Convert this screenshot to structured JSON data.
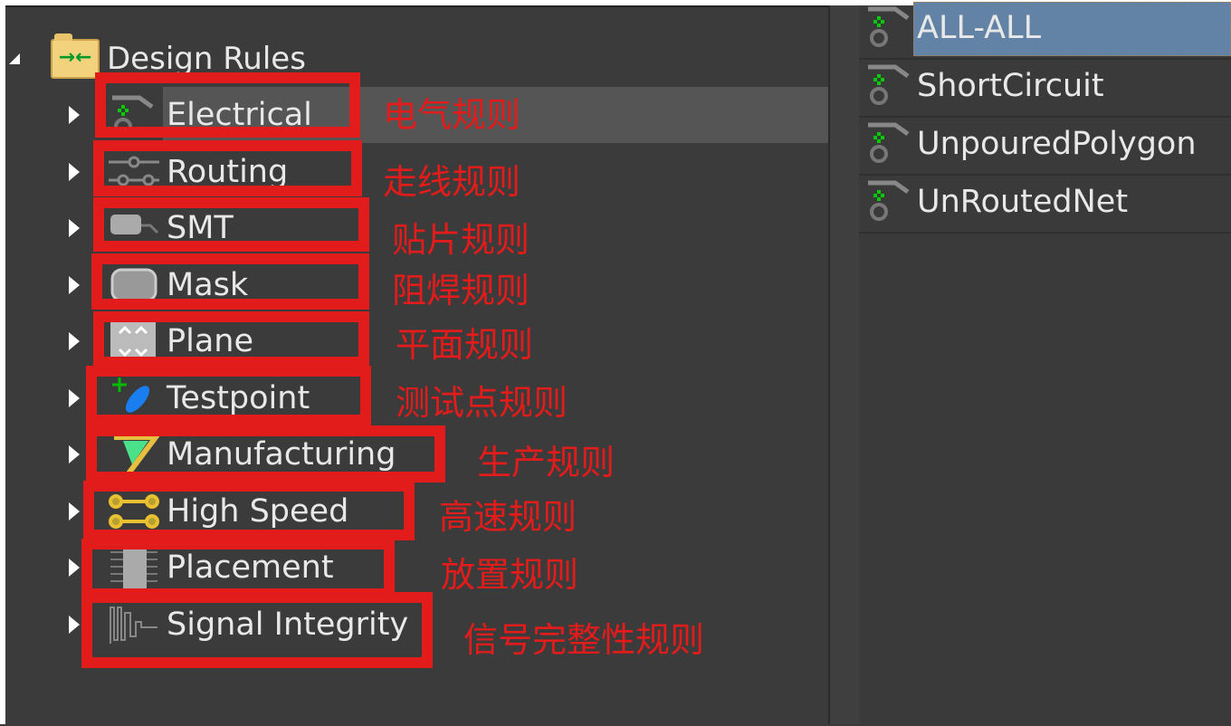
{
  "tree": {
    "root": {
      "label": "Design Rules",
      "icon": "design-rules-folder-icon"
    },
    "items": [
      {
        "label": "Electrical",
        "icon": "electrical-icon",
        "annotation": "电气规则",
        "selected": true
      },
      {
        "label": "Routing",
        "icon": "routing-icon",
        "annotation": "走线规则"
      },
      {
        "label": "SMT",
        "icon": "smt-icon",
        "annotation": "贴片规则"
      },
      {
        "label": "Mask",
        "icon": "mask-icon",
        "annotation": "阻焊规则"
      },
      {
        "label": "Plane",
        "icon": "plane-icon",
        "annotation": "平面规则"
      },
      {
        "label": "Testpoint",
        "icon": "testpoint-icon",
        "annotation": "测试点规则"
      },
      {
        "label": "Manufacturing",
        "icon": "manufacturing-icon",
        "annotation": "生产规则"
      },
      {
        "label": "High Speed",
        "icon": "high-speed-icon",
        "annotation": "高速规则"
      },
      {
        "label": "Placement",
        "icon": "placement-icon",
        "annotation": "放置规则"
      },
      {
        "label": "Signal Integrity",
        "icon": "signal-integrity-icon",
        "annotation": "信号完整性规则"
      }
    ]
  },
  "rule_list": {
    "items": [
      {
        "label": "ALL-ALL",
        "selected": true
      },
      {
        "label": "ShortCircuit"
      },
      {
        "label": "UnpouredPolygon"
      },
      {
        "label": "UnRoutedNet"
      }
    ]
  },
  "colors": {
    "annotation_red": "#e21b1b",
    "selection_blue": "#6283a5",
    "panel_bg": "#3b3b3b"
  }
}
